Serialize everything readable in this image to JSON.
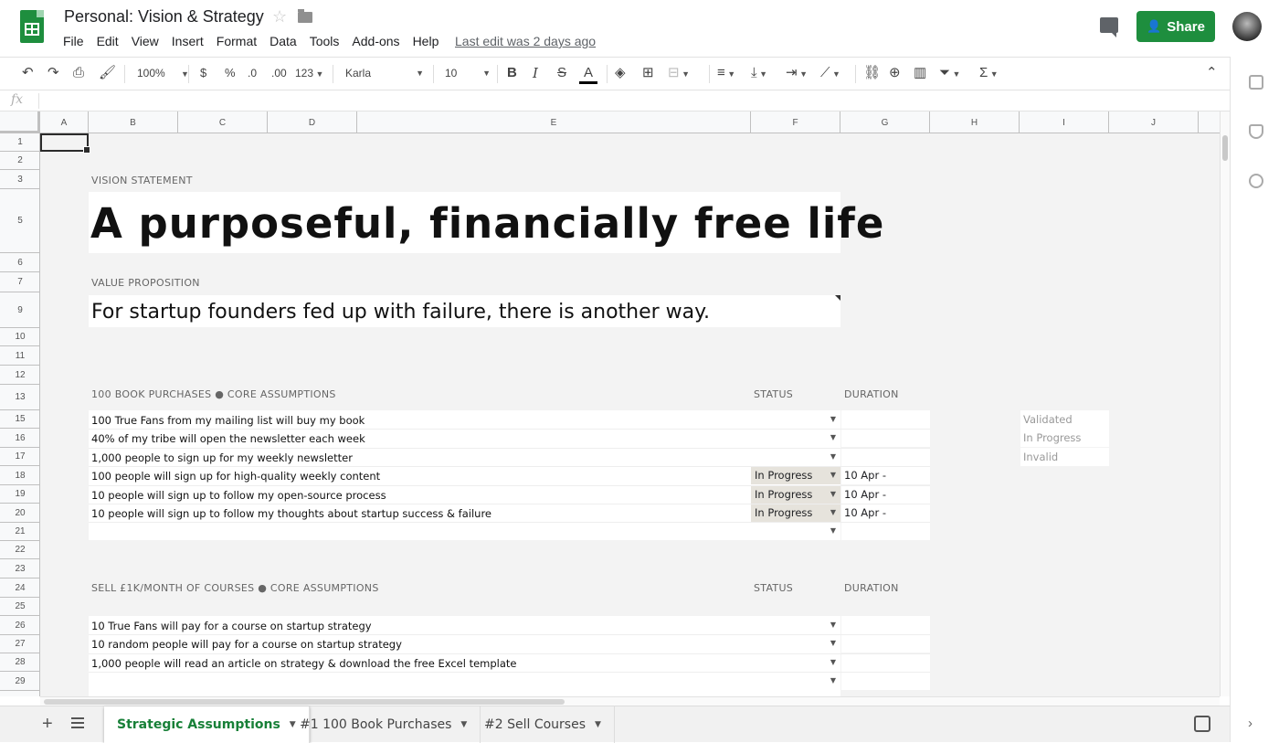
{
  "doc": {
    "title": "Personal: Vision & Strategy",
    "last_edit": "Last edit was 2 days ago",
    "share_label": "Share"
  },
  "menu": [
    "File",
    "Edit",
    "View",
    "Insert",
    "Format",
    "Data",
    "Tools",
    "Add-ons",
    "Help"
  ],
  "toolbar": {
    "zoom": "100%",
    "currency": "$",
    "percent": "%",
    "dec_decrease": ".0",
    "dec_increase": ".00",
    "more_formats": "123",
    "font": "Karla",
    "font_size": "10",
    "bold": "B",
    "italic": "I",
    "strike": "S",
    "text_color": "A",
    "sigma": "Σ"
  },
  "columns": [
    "A",
    "B",
    "C",
    "D",
    "E",
    "F",
    "G",
    "H",
    "I",
    "J"
  ],
  "rows": [
    "1",
    "2",
    "3",
    "5",
    "6",
    "7",
    "9",
    "10",
    "11",
    "12",
    "13",
    "15",
    "16",
    "17",
    "18",
    "19",
    "20",
    "21",
    "22",
    "23",
    "24",
    "25",
    "26",
    "27",
    "28",
    "29"
  ],
  "sheet": {
    "vision_label": "VISION STATEMENT",
    "vision": "A purposeful, financially free life",
    "value_label": "VALUE PROPOSITION",
    "value": "For startup founders fed up with failure, there is another way.",
    "section1": {
      "title": "100 BOOK PURCHASES ● CORE ASSUMPTIONS",
      "status_header": "STATUS",
      "duration_header": "DURATION",
      "assumptions": [
        {
          "text": "100 True Fans from my mailing list will buy my book",
          "status": "",
          "duration": ""
        },
        {
          "text": "40% of my tribe will open the newsletter each week",
          "status": "",
          "duration": ""
        },
        {
          "text": "1,000 people to sign up for my weekly newsletter",
          "status": "",
          "duration": ""
        },
        {
          "text": "100 people will sign up for high-quality weekly content",
          "status": "In Progress",
          "duration": "10 Apr -"
        },
        {
          "text": "10 people will sign up to follow my open-source process",
          "status": "In Progress",
          "duration": "10 Apr -"
        },
        {
          "text": "10 people will sign up to follow my thoughts about startup success & failure",
          "status": "In Progress",
          "duration": "10 Apr -"
        },
        {
          "text": "",
          "status": "",
          "duration": ""
        }
      ]
    },
    "legend": [
      "Validated",
      "In Progress",
      "Invalid"
    ],
    "section2": {
      "title": "SELL £1K/MONTH OF COURSES ● CORE ASSUMPTIONS",
      "status_header": "STATUS",
      "duration_header": "DURATION",
      "assumptions": [
        {
          "text": "10 True Fans will pay for a course on startup strategy",
          "status": "",
          "duration": ""
        },
        {
          "text": "10 random people  will pay for a course on startup strategy",
          "status": "",
          "duration": ""
        },
        {
          "text": "1,000 people will read an article on strategy & download the free Excel template",
          "status": "",
          "duration": ""
        },
        {
          "text": "",
          "status": "",
          "duration": ""
        }
      ]
    }
  },
  "tabs": [
    "Strategic Assumptions",
    "#1 100 Book Purchases",
    "#2 Sell Courses"
  ],
  "colors": {
    "brand_green": "#1e8e3e",
    "active_tab_text": "#188038",
    "in_progress_fill": "#e6e3dc",
    "sheet_bg": "#f3f3f3"
  }
}
